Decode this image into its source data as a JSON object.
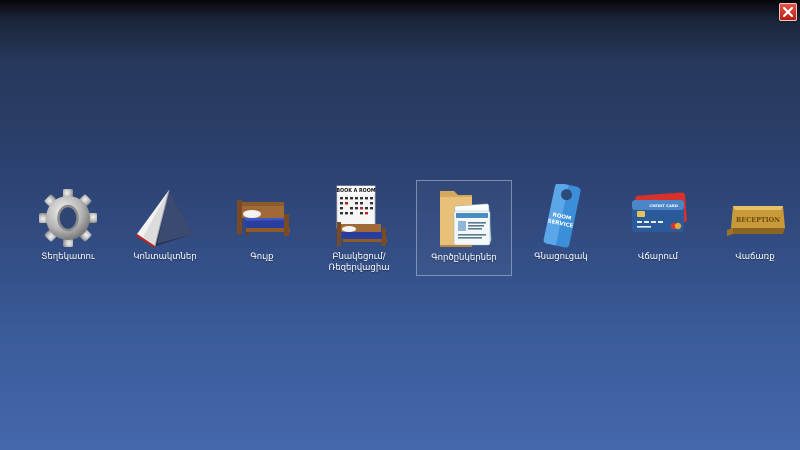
{
  "window": {
    "close_icon": "close-icon"
  },
  "menu": {
    "items": [
      {
        "id": "settings",
        "icon": "gear-icon",
        "lines": [
          "Տեղեկատու"
        ]
      },
      {
        "id": "contacts",
        "icon": "book-icon",
        "lines": [
          "Կոնտակտներ"
        ]
      },
      {
        "id": "rooms",
        "icon": "bed-icon",
        "lines": [
          "Գույք"
        ]
      },
      {
        "id": "booking",
        "icon": "booking-calendar-icon",
        "lines": [
          "Բնակեցում/",
          "Ռեզերվացիա"
        ]
      },
      {
        "id": "documents",
        "icon": "folder-documents-icon",
        "lines": [
          "Գործընկերներ"
        ],
        "selected": true
      },
      {
        "id": "room-service",
        "icon": "door-hanger-icon",
        "lines": [
          "Գնացուցակ"
        ]
      },
      {
        "id": "payment",
        "icon": "credit-card-icon",
        "lines": [
          "Վճարում"
        ]
      },
      {
        "id": "reception",
        "icon": "reception-sign-icon",
        "lines": [
          "Վաճառք"
        ]
      }
    ],
    "icon_texts": {
      "booking_sign": "BOOK A ROOM",
      "room_service_1": "ROOM",
      "room_service_2": "SERVICE",
      "credit_card": "CREDIT CARD",
      "reception": "RECEPTION"
    }
  }
}
